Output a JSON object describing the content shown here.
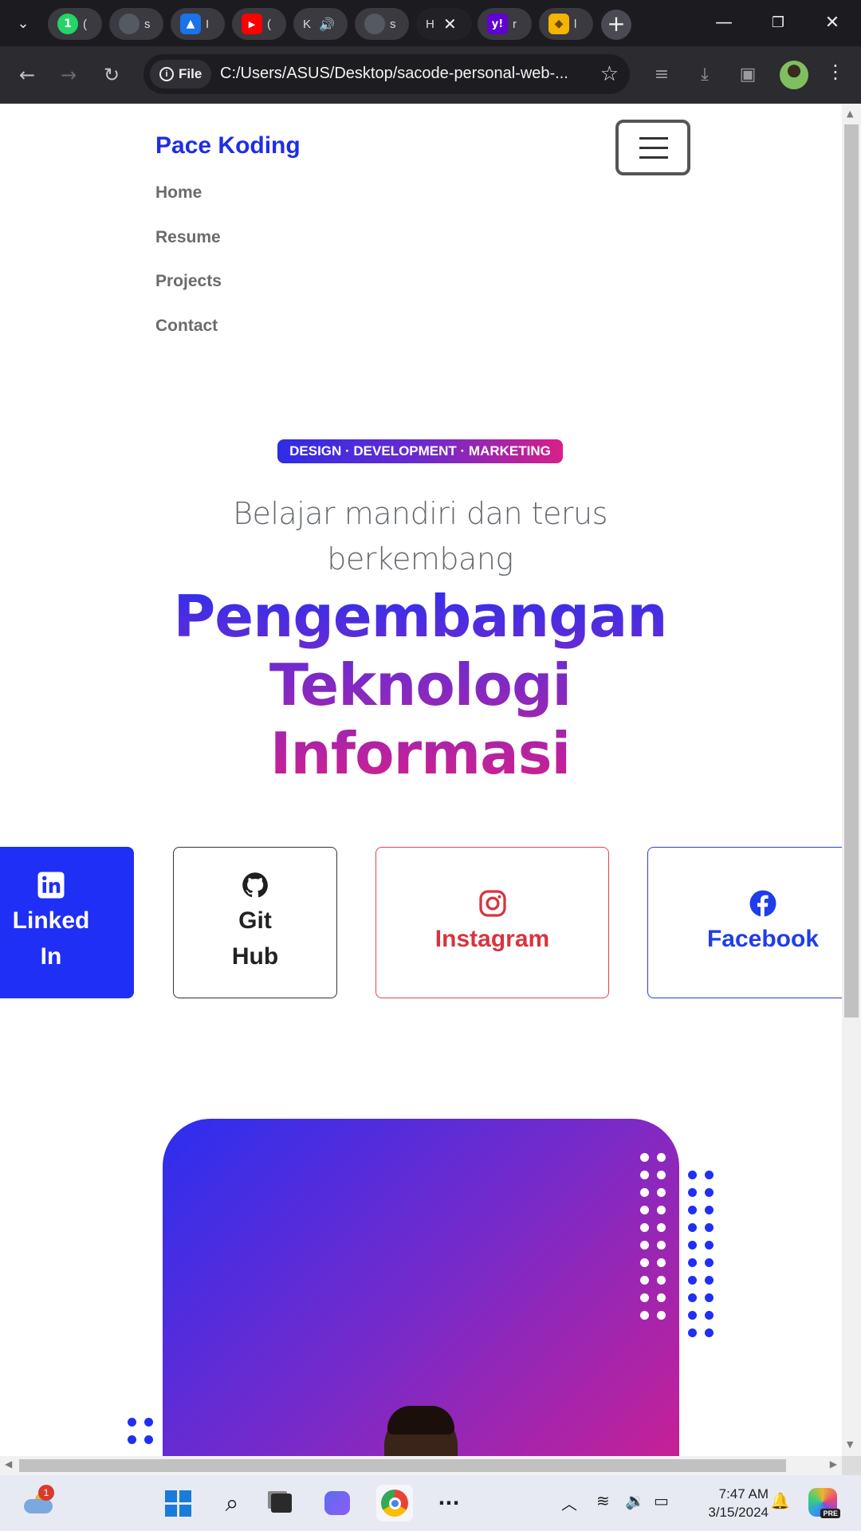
{
  "browser": {
    "tabs": [
      {
        "favicon": "whatsapp-icon",
        "label": "(",
        "color": "#25d366",
        "glyph": "1"
      },
      {
        "favicon": "github-icon",
        "label": "s",
        "color": "#555a60",
        "glyph": "●"
      },
      {
        "favicon": "contacts-icon",
        "label": "I",
        "color": "#1a73e8",
        "glyph": "▲"
      },
      {
        "favicon": "youtube-icon",
        "label": "(",
        "color": "#ff0000",
        "glyph": "▶"
      },
      {
        "favicon": "tab-initial",
        "label": "K",
        "color": "#3a3a40",
        "glyph": ""
      },
      {
        "favicon": "github-icon",
        "label": "s",
        "color": "#555a60",
        "glyph": "●"
      },
      {
        "favicon": "page-icon",
        "label": "H",
        "color": "#222226",
        "glyph": ""
      },
      {
        "favicon": "yahoo-icon",
        "label": "r",
        "color": "#6001d2",
        "glyph": "y!"
      },
      {
        "favicon": "stack-icon",
        "label": "l",
        "color": "#f4b400",
        "glyph": "◆"
      }
    ],
    "active_tab_index": 6,
    "address": "C:/Users/ASUS/Desktop/sacode-personal-web-...",
    "file_chip": "File"
  },
  "site": {
    "brand": "Pace Koding",
    "nav": [
      "Home",
      "Resume",
      "Projects",
      "Contact"
    ],
    "badge": "DESIGN · DEVELOPMENT · MARKETING",
    "subheading_line1": "Belajar mandiri dan terus",
    "subheading_line2": "berkembang",
    "headline": [
      "Pengembangan",
      "Teknologi",
      "Informasi"
    ],
    "social": {
      "linkedin_line1": "Linked",
      "linkedin_line2": "In",
      "github_line1": "Git",
      "github_line2": "Hub",
      "instagram": "Instagram",
      "facebook": "Facebook"
    }
  },
  "colors": {
    "brand_blue": "#1f2de8",
    "gradient_start": "#2b2ff0",
    "gradient_mid": "#7a2ac8",
    "gradient_end": "#d21f8e",
    "instagram_red": "#d8343e"
  },
  "taskbar": {
    "weather_badge": "1",
    "time": "7:47 AM",
    "date": "3/15/2024",
    "copilot_tag": "PRE"
  }
}
